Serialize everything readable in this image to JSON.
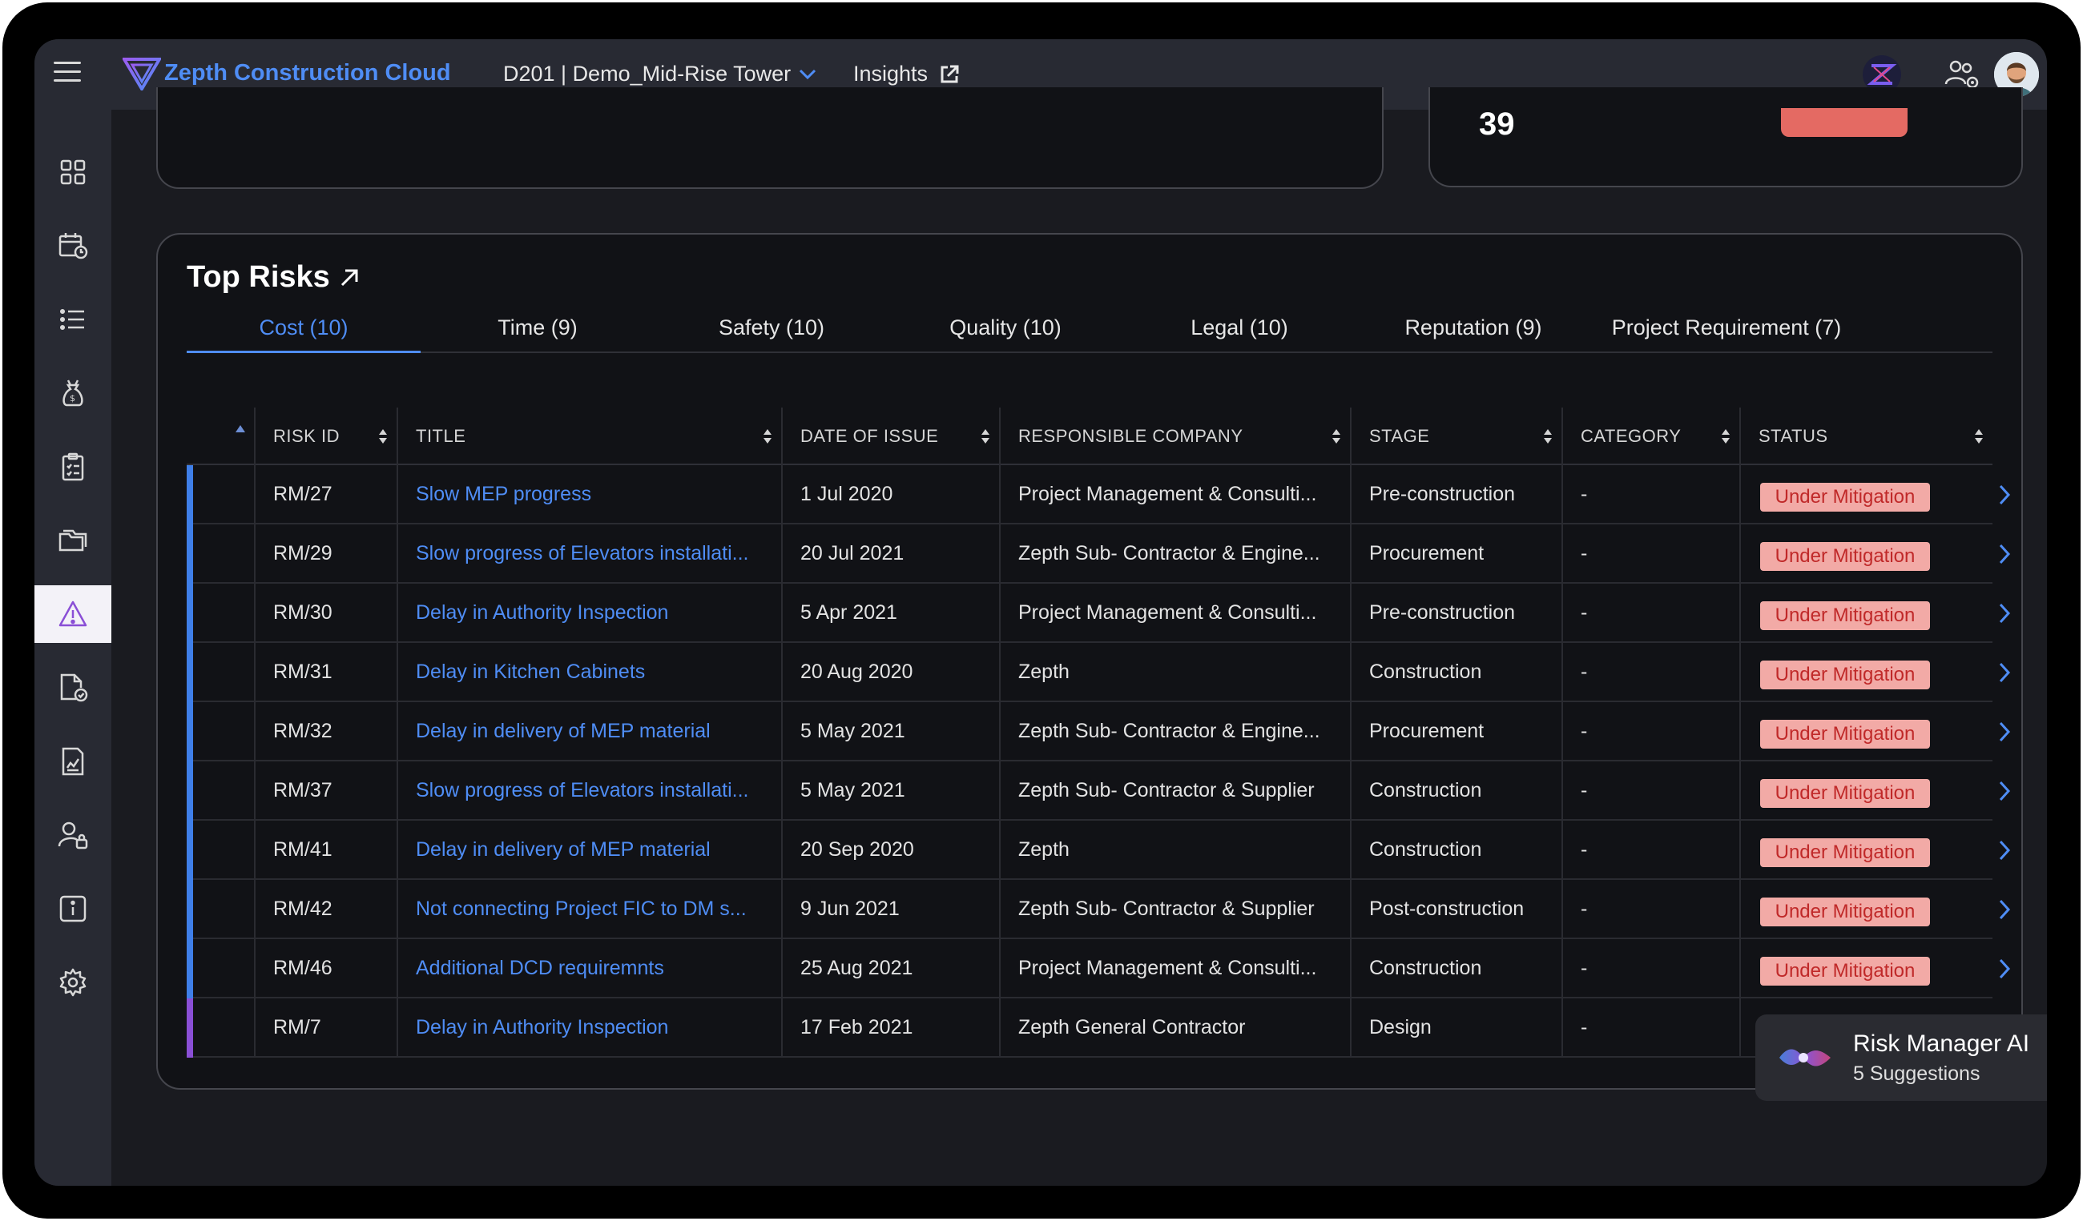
{
  "header": {
    "brand": "Zepth Construction Cloud",
    "project": "D201 | Demo_Mid-Rise Tower",
    "insights": "Insights"
  },
  "kpi": {
    "value": "39"
  },
  "risks": {
    "title": "Top Risks",
    "tabs": [
      {
        "label": "Cost (10)",
        "active": true
      },
      {
        "label": "Time (9)"
      },
      {
        "label": "Safety (10)"
      },
      {
        "label": "Quality (10)"
      },
      {
        "label": "Legal (10)"
      },
      {
        "label": "Reputation (9)"
      },
      {
        "label": "Project Requirement (7)"
      }
    ],
    "columns": [
      "RISK ID",
      "TITLE",
      "DATE OF ISSUE",
      "RESPONSIBLE COMPANY",
      "STAGE",
      "CATEGORY",
      "STATUS"
    ],
    "rows": [
      {
        "id": "RM/27",
        "title": "Slow MEP progress",
        "date": "1 Jul 2020",
        "company": "Project Management & Consulti...",
        "stage": "Pre-construction",
        "category": "-",
        "status": "Under Mitigation",
        "bar": "#3f7fe9"
      },
      {
        "id": "RM/29",
        "title": "Slow progress of Elevators installati...",
        "date": "20 Jul 2021",
        "company": "Zepth Sub- Contractor & Engine...",
        "stage": "Procurement",
        "category": "-",
        "status": "Under Mitigation",
        "bar": "#3f7fe9"
      },
      {
        "id": "RM/30",
        "title": "Delay in Authority Inspection",
        "date": "5 Apr 2021",
        "company": "Project Management & Consulti...",
        "stage": "Pre-construction",
        "category": "-",
        "status": "Under Mitigation",
        "bar": "#3f7fe9"
      },
      {
        "id": "RM/31",
        "title": "Delay in Kitchen Cabinets",
        "date": "20 Aug 2020",
        "company": "Zepth",
        "stage": "Construction",
        "category": "-",
        "status": "Under Mitigation",
        "bar": "#3f7fe9"
      },
      {
        "id": "RM/32",
        "title": "Delay in delivery of MEP material",
        "date": "5 May 2021",
        "company": "Zepth Sub- Contractor & Engine...",
        "stage": "Procurement",
        "category": "-",
        "status": "Under Mitigation",
        "bar": "#3f7fe9"
      },
      {
        "id": "RM/37",
        "title": "Slow progress of Elevators installati...",
        "date": "5 May 2021",
        "company": "Zepth Sub- Contractor & Supplier",
        "stage": "Construction",
        "category": "-",
        "status": "Under Mitigation",
        "bar": "#3f7fe9"
      },
      {
        "id": "RM/41",
        "title": "Delay in delivery of MEP material",
        "date": "20 Sep 2020",
        "company": "Zepth",
        "stage": "Construction",
        "category": "-",
        "status": "Under Mitigation",
        "bar": "#3f7fe9"
      },
      {
        "id": "RM/42",
        "title": "Not connecting Project FIC to DM s...",
        "date": "9 Jun 2021",
        "company": "Zepth Sub- Contractor & Supplier",
        "stage": "Post-construction",
        "category": "-",
        "status": "Under Mitigation",
        "bar": "#3f7fe9"
      },
      {
        "id": "RM/46",
        "title": "Additional DCD requiremnts",
        "date": "25 Aug 2021",
        "company": "Project Management & Consulti...",
        "stage": "Construction",
        "category": "-",
        "status": "Under Mitigation",
        "bar": "#3f7fe9"
      },
      {
        "id": "RM/7",
        "title": "Delay in Authority Inspection",
        "date": "17 Feb 2021",
        "company": "Zepth General Contractor",
        "stage": "Design",
        "category": "-",
        "status": "",
        "bar": "#8a4fd6"
      }
    ]
  },
  "ai": {
    "title": "Risk Manager AI",
    "subtitle": "5 Suggestions"
  },
  "colors": {
    "accent": "#4f8df5",
    "status_bg": "#f2aaa6",
    "status_text": "#c02929",
    "active_sidebar": "#f3f2f8"
  },
  "icons": {
    "sidebar": [
      "dashboard-icon",
      "schedule-icon",
      "list-icon",
      "money-bag-icon",
      "checklist-icon",
      "folder-icon",
      "warning-icon",
      "document-check-icon",
      "report-icon",
      "user-lock-icon",
      "info-icon",
      "gear-icon"
    ]
  }
}
